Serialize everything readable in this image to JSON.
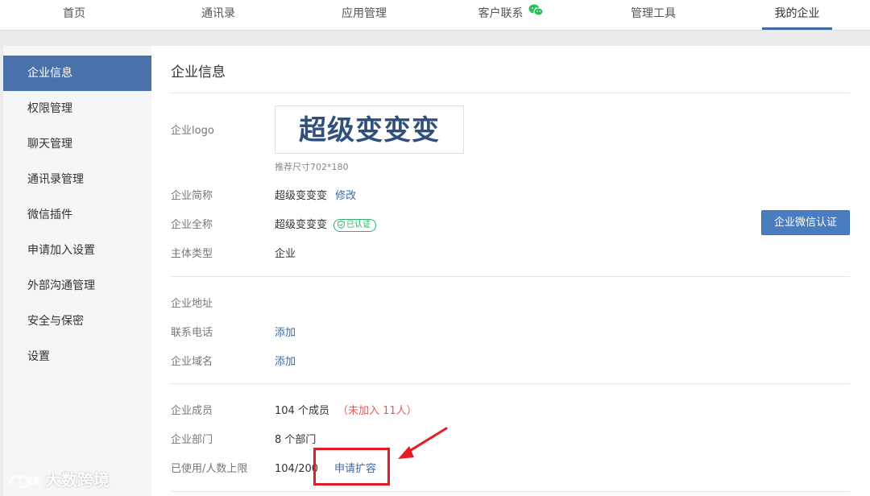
{
  "topnav": {
    "items": [
      {
        "label": "首页"
      },
      {
        "label": "通讯录"
      },
      {
        "label": "应用管理"
      },
      {
        "label": "客户联系"
      },
      {
        "label": "管理工具"
      },
      {
        "label": "我的企业"
      }
    ],
    "active_index": 5
  },
  "sidebar": {
    "items": [
      {
        "label": "企业信息"
      },
      {
        "label": "权限管理"
      },
      {
        "label": "聊天管理"
      },
      {
        "label": "通讯录管理"
      },
      {
        "label": "微信插件"
      },
      {
        "label": "申请加入设置"
      },
      {
        "label": "外部沟通管理"
      },
      {
        "label": "安全与保密"
      },
      {
        "label": "设置"
      }
    ],
    "active_index": 0
  },
  "main": {
    "title": "企业信息",
    "logo": {
      "label": "企业logo",
      "text": "超级变变变",
      "hint": "推荐尺寸702*180"
    },
    "short_name": {
      "label": "企业简称",
      "value": "超级变变变",
      "action": "修改"
    },
    "full_name": {
      "label": "企业全称",
      "value": "超级变变变",
      "badge": "已认证"
    },
    "entity_type": {
      "label": "主体类型",
      "value": "企业"
    },
    "wechat_verify_button": "企业微信认证",
    "address": {
      "label": "企业地址"
    },
    "phone": {
      "label": "联系电话",
      "action": "添加"
    },
    "domain": {
      "label": "企业域名",
      "action": "添加"
    },
    "members": {
      "label": "企业成员",
      "value": "104 个成员",
      "not_joined": "（未加入 11人）"
    },
    "departments": {
      "label": "企业部门",
      "value": "8 个部门"
    },
    "usage": {
      "label": "已使用/人数上限",
      "value": "104/200",
      "action": "申请扩容"
    }
  },
  "watermark": "大数跨境",
  "colors": {
    "accent": "#4a72aa",
    "link": "#3a6aa6",
    "verified": "#33b06b",
    "warning": "#e05b5b",
    "highlight": "#e51c23"
  }
}
